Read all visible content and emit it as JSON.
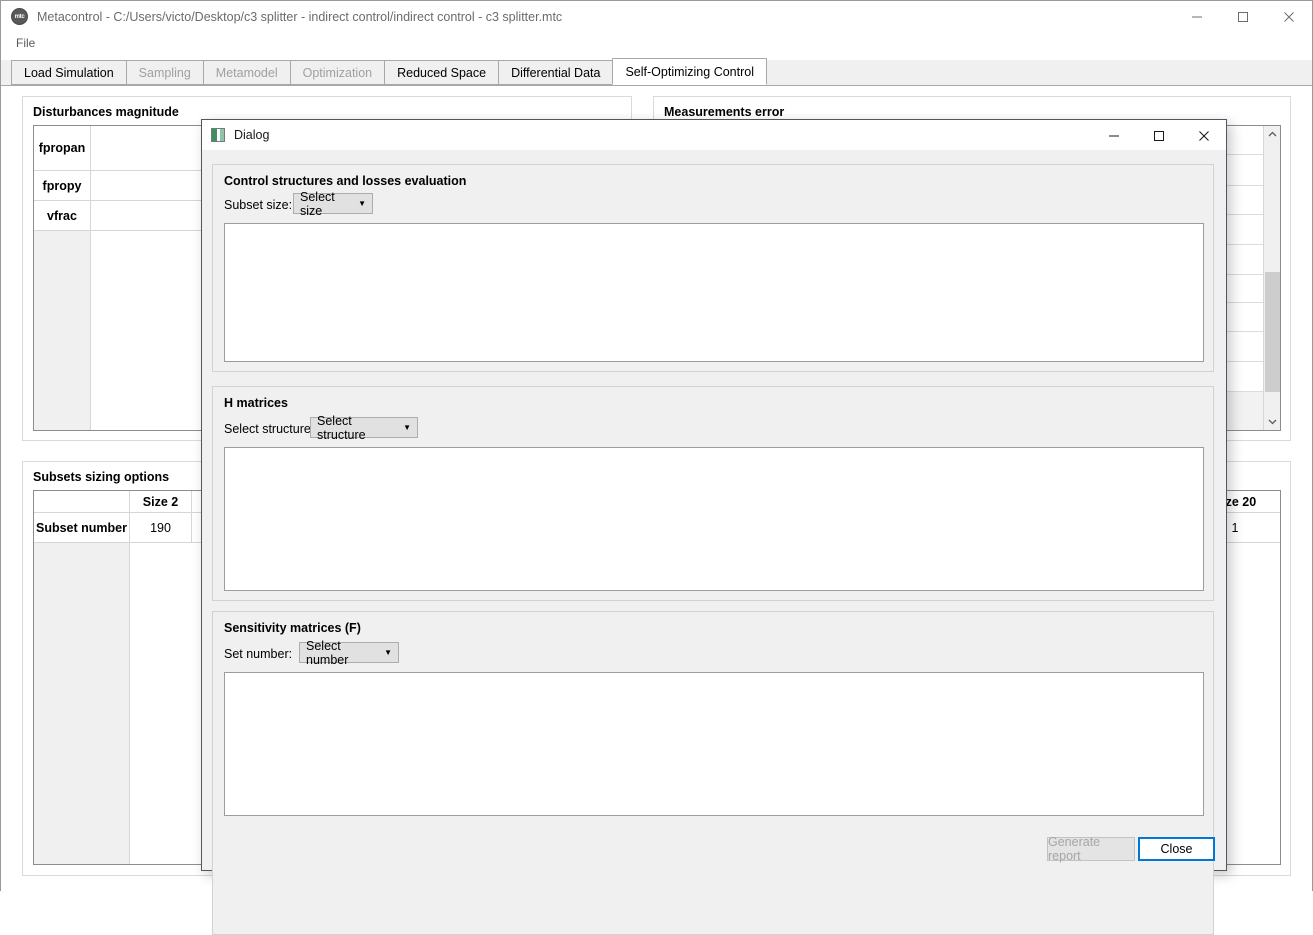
{
  "main_window": {
    "title": "Metacontrol - C:/Users/victo/Desktop/c3 splitter - indirect control/indirect control - c3 splitter.mtc",
    "app_icon": "metacontrol-logo-icon",
    "menu": {
      "file": "File"
    },
    "window_controls": {
      "minimize": "minimize-icon",
      "maximize": "maximize-icon",
      "close": "close-icon"
    },
    "tabs": [
      {
        "label": "Load Simulation",
        "enabled": true,
        "active": false
      },
      {
        "label": "Sampling",
        "enabled": false,
        "active": false
      },
      {
        "label": "Metamodel",
        "enabled": false,
        "active": false
      },
      {
        "label": "Optimization",
        "enabled": false,
        "active": false
      },
      {
        "label": "Reduced Space",
        "enabled": true,
        "active": false
      },
      {
        "label": "Differential Data",
        "enabled": true,
        "active": false
      },
      {
        "label": "Self-Optimizing Control",
        "enabled": true,
        "active": true
      }
    ]
  },
  "disturbances": {
    "group_title": "Disturbances magnitude",
    "rows": [
      "fpropan",
      "fpropy",
      "vfrac"
    ],
    "values": [
      "",
      "",
      ""
    ]
  },
  "measurements": {
    "group_title": "Measurements error",
    "scrollbar": {
      "up": "chevron-up-icon",
      "down": "chevron-down-icon"
    }
  },
  "subsets": {
    "group_title": "Subsets sizing options",
    "row_header": "Subset number",
    "columns": [
      "Size 2",
      "Size 20"
    ],
    "values": [
      "190",
      "1"
    ]
  },
  "dialog": {
    "title": "Dialog",
    "icon": "window-app-icon",
    "window_controls": {
      "minimize": "minimize-icon",
      "maximize": "maximize-icon",
      "close": "close-icon"
    },
    "sections": [
      {
        "title": "Control structures and losses evaluation",
        "label": "Subset size:",
        "combo_value": "Select size",
        "list_content": ""
      },
      {
        "title": "H matrices",
        "label": "Select structure:",
        "combo_value": "Select structure",
        "list_content": ""
      },
      {
        "title": "Sensitivity matrices (F)",
        "label": "Set number:",
        "combo_value": "Select number",
        "list_content": ""
      }
    ],
    "buttons": {
      "generate_report": "Generate report",
      "close": "Close"
    }
  },
  "colors": {
    "accent": "#0078d7",
    "window_bg": "#f0f0f0",
    "content_bg": "#ffffff",
    "border": "#d2d2d2",
    "disabled_text": "#a0a0a0"
  }
}
